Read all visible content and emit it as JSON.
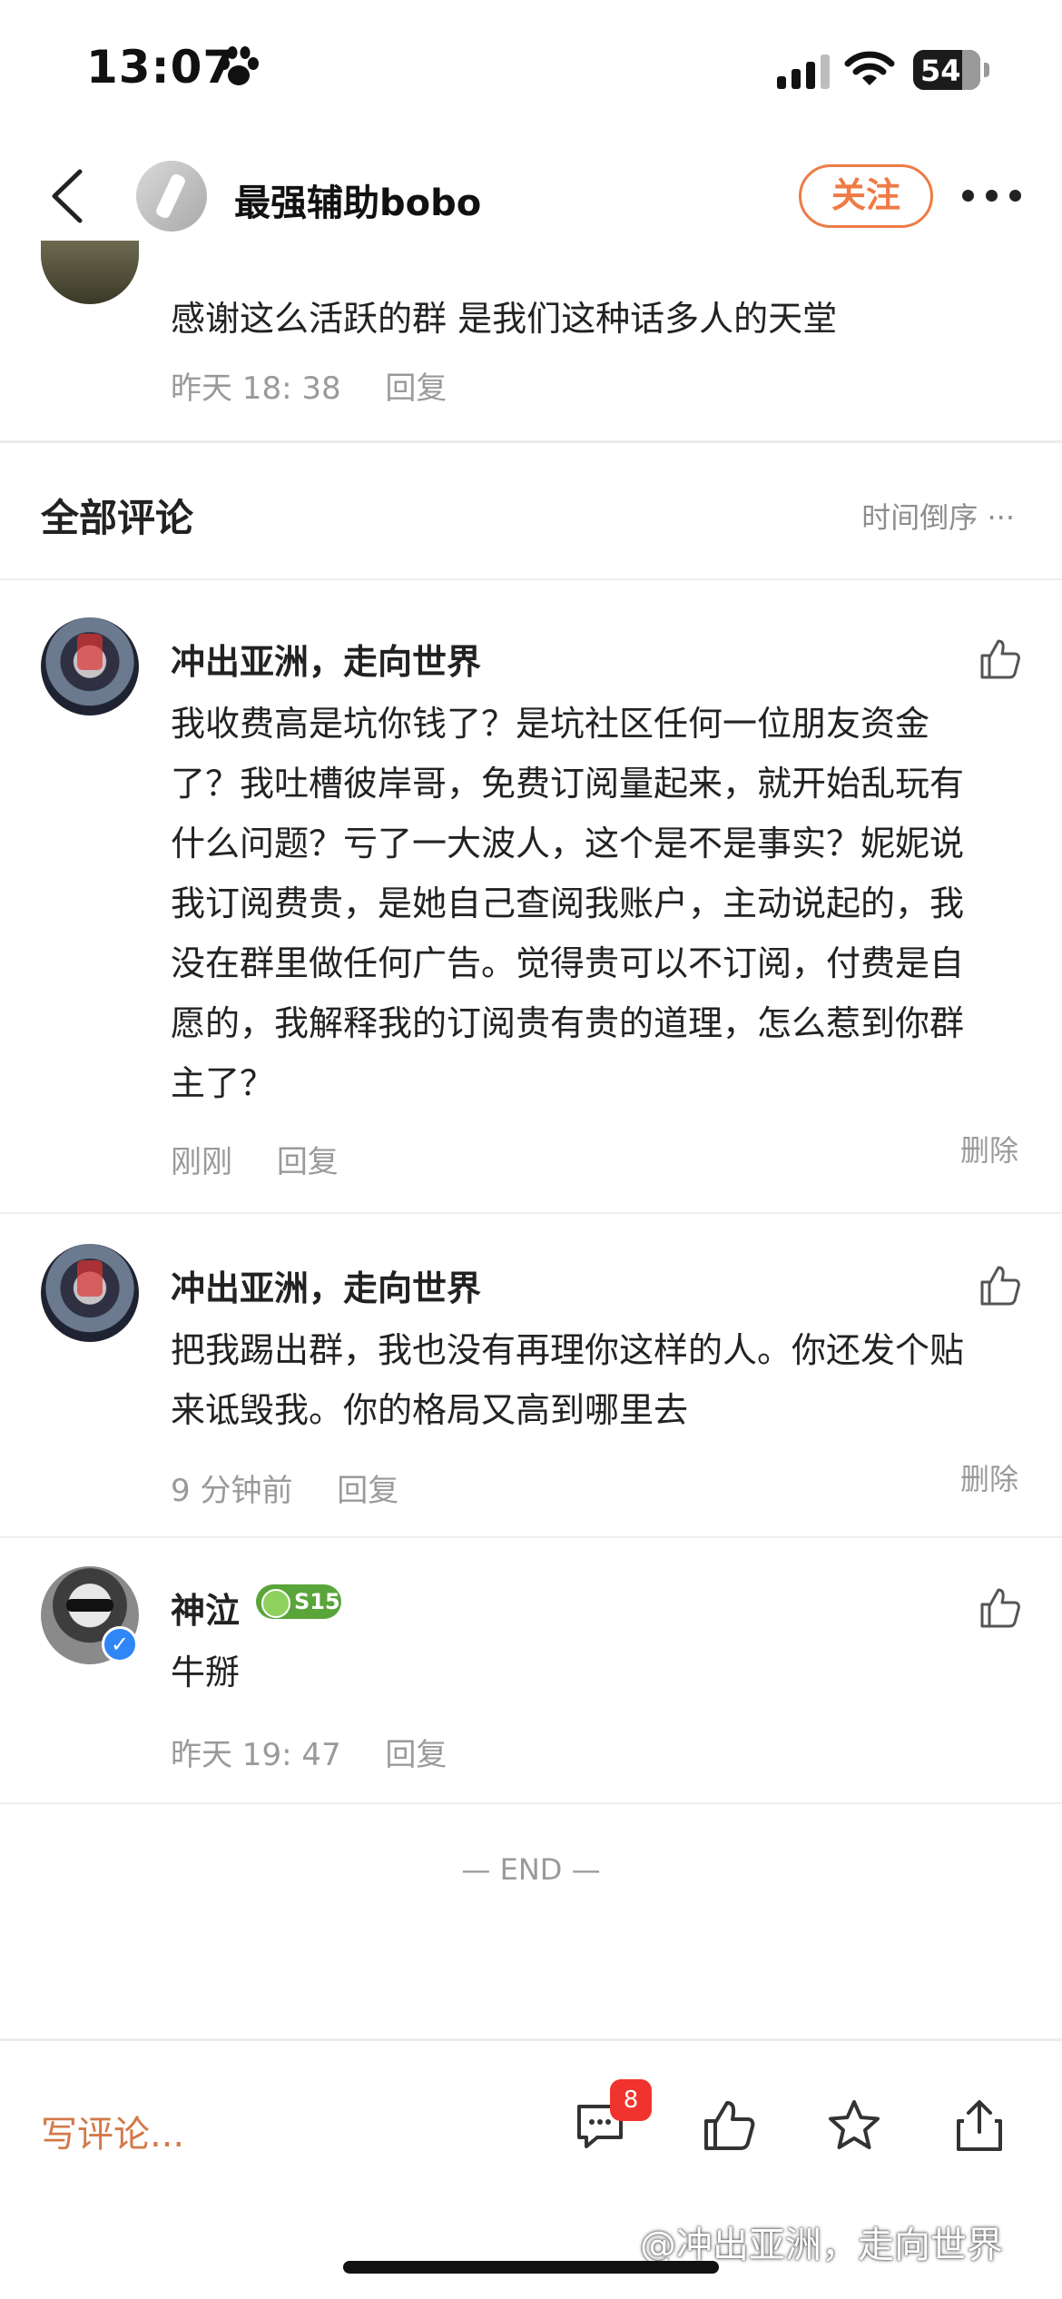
{
  "status": {
    "time": "13:07",
    "battery": "54"
  },
  "nav": {
    "title": "最强辅助bobo",
    "follow_label": "关注"
  },
  "partial_comment": {
    "text": "感谢这么活跃的群 是我们这种话多人的天堂",
    "time": "昨天 18: 38",
    "reply": "回复"
  },
  "section": {
    "title": "全部评论",
    "sort_label": "时间倒序"
  },
  "comments": [
    {
      "name": "冲出亚洲，走向世界",
      "lines": [
        "我收费高是坑你钱了？是坑社区任何一位朋友资金",
        "了？我吐槽彼岸哥，免费订阅量起来，就开始乱玩有",
        "什么问题？亏了一大波人，这个是不是事实？妮妮说",
        "我订阅费贵，是她自己查阅我账户，主动说起的，我",
        "没在群里做任何广告。觉得贵可以不订阅，付费是自",
        "愿的，我解释我的订阅贵有贵的道理，怎么惹到你群",
        "主了？"
      ],
      "time": "刚刚",
      "reply": "回复",
      "delete": "删除"
    },
    {
      "name": "冲出亚洲，走向世界",
      "lines": [
        "把我踢出群，我也没有再理你这样的人。你还发个贴",
        "来诋毁我。你的格局又高到哪里去"
      ],
      "time": "9 分钟前",
      "reply": "回复",
      "delete": "删除"
    },
    {
      "name": "神泣",
      "badge": "S15",
      "lines": [
        "牛掰"
      ],
      "time": "昨天 19: 47",
      "reply": "回复"
    }
  ],
  "end_text": "— END —",
  "bottom": {
    "write_placeholder": "写评论...",
    "comment_count": "8"
  },
  "watermark": "@冲出亚洲，走向世界",
  "colors": {
    "accent": "#ee7b45",
    "badge_red": "#f0342d",
    "meta_gray": "#9a9a9a"
  }
}
